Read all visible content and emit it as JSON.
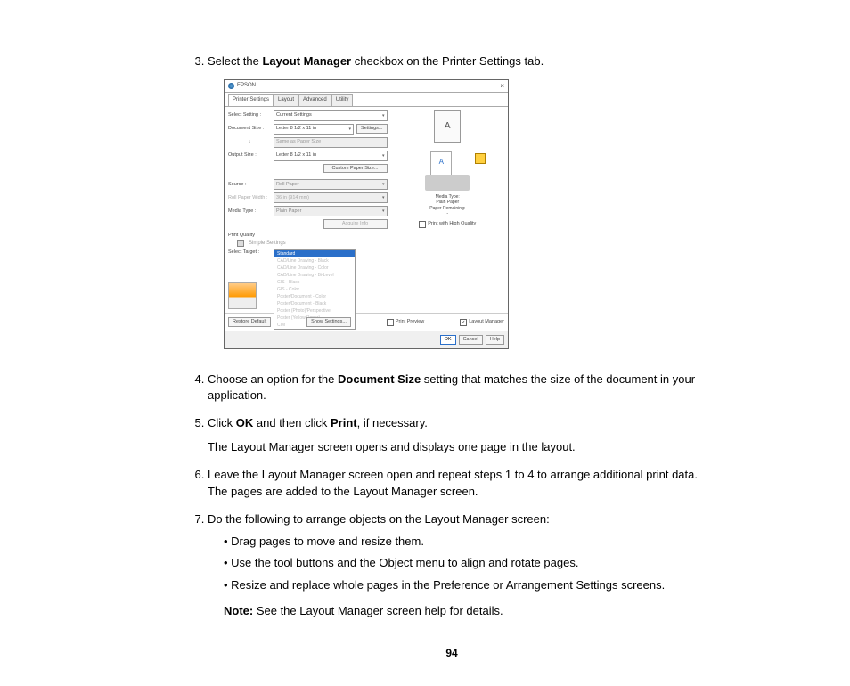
{
  "steps": {
    "s3_pre": "Select the ",
    "s3_bold": "Layout Manager",
    "s3_post": " checkbox on the Printer Settings tab.",
    "s4_pre": "Choose an option for the ",
    "s4_bold": "Document Size",
    "s4_post": " setting that matches the size of the document in your application.",
    "s5_pre": "Click ",
    "s5_b1": "OK",
    "s5_mid": " and then click ",
    "s5_b2": "Print",
    "s5_post": ", if necessary.",
    "s5_follow": "The Layout Manager screen opens and displays one page in the layout.",
    "s6": "Leave the Layout Manager screen open and repeat steps 1 to 4 to arrange additional print data. The pages are added to the Layout Manager screen.",
    "s7": "Do the following to arrange objects on the Layout Manager screen:",
    "b1": "Drag pages to move and resize them.",
    "b2": "Use the tool buttons and the Object menu to align and rotate pages.",
    "b3": "Resize and replace whole pages in the Preference or Arrangement Settings screens.",
    "note_label": "Note:",
    "note_text": " See the Layout Manager screen help for details."
  },
  "dialog": {
    "brand": "EPSON",
    "tabs": {
      "t1": "Printer Settings",
      "t2": "Layout",
      "t3": "Advanced",
      "t4": "Utility"
    },
    "select_setting_lbl": "Select Setting :",
    "select_setting_val": "Current Settings",
    "doc_size_lbl": "Document Size :",
    "doc_size_val": "Letter 8 1/2 x 11 in",
    "settings_btn": "Settings...",
    "same_as": "Same as Paper Size",
    "output_lbl": "Output Size :",
    "output_val": "Letter 8 1/2 x 11 in",
    "custom_btn": "Custom Paper Size...",
    "source_lbl": "Source :",
    "source_val": "Roll Paper",
    "roll_lbl": "Roll Paper Width :",
    "roll_val": "36 in (914 mm)",
    "media_lbl": "Media Type :",
    "media_val": "Plain Paper",
    "acquire_btn": "Acquire Info",
    "pq_lbl": "Print Quality",
    "simple_cb": "Simple Settings",
    "sel_target_lbl": "Select Target :",
    "target_selected": "Standard",
    "target_opts": [
      "CAD/Line Drawing - Black",
      "CAD/Line Drawing - Color",
      "CAD/Line Drawing - Bi-Level",
      "GIS - Black",
      "GIS - Color",
      "Poster/Document - Color",
      "Poster/Document - Black",
      "Poster (Photo)/Perspective",
      "Poster (Yellow Paper)",
      "CIM"
    ],
    "hq_cb": "Print with High Quality",
    "right_media": "Media Type:",
    "right_media_v": "Plain Paper",
    "right_remain": "Paper Remaining:",
    "restore_btn": "Restore Default",
    "show_btn": "Show Settings...",
    "preview_cb": "Print Preview",
    "layout_cb": "Layout Manager",
    "ok": "OK",
    "cancel": "Cancel",
    "help": "Help"
  },
  "page_number": "94"
}
